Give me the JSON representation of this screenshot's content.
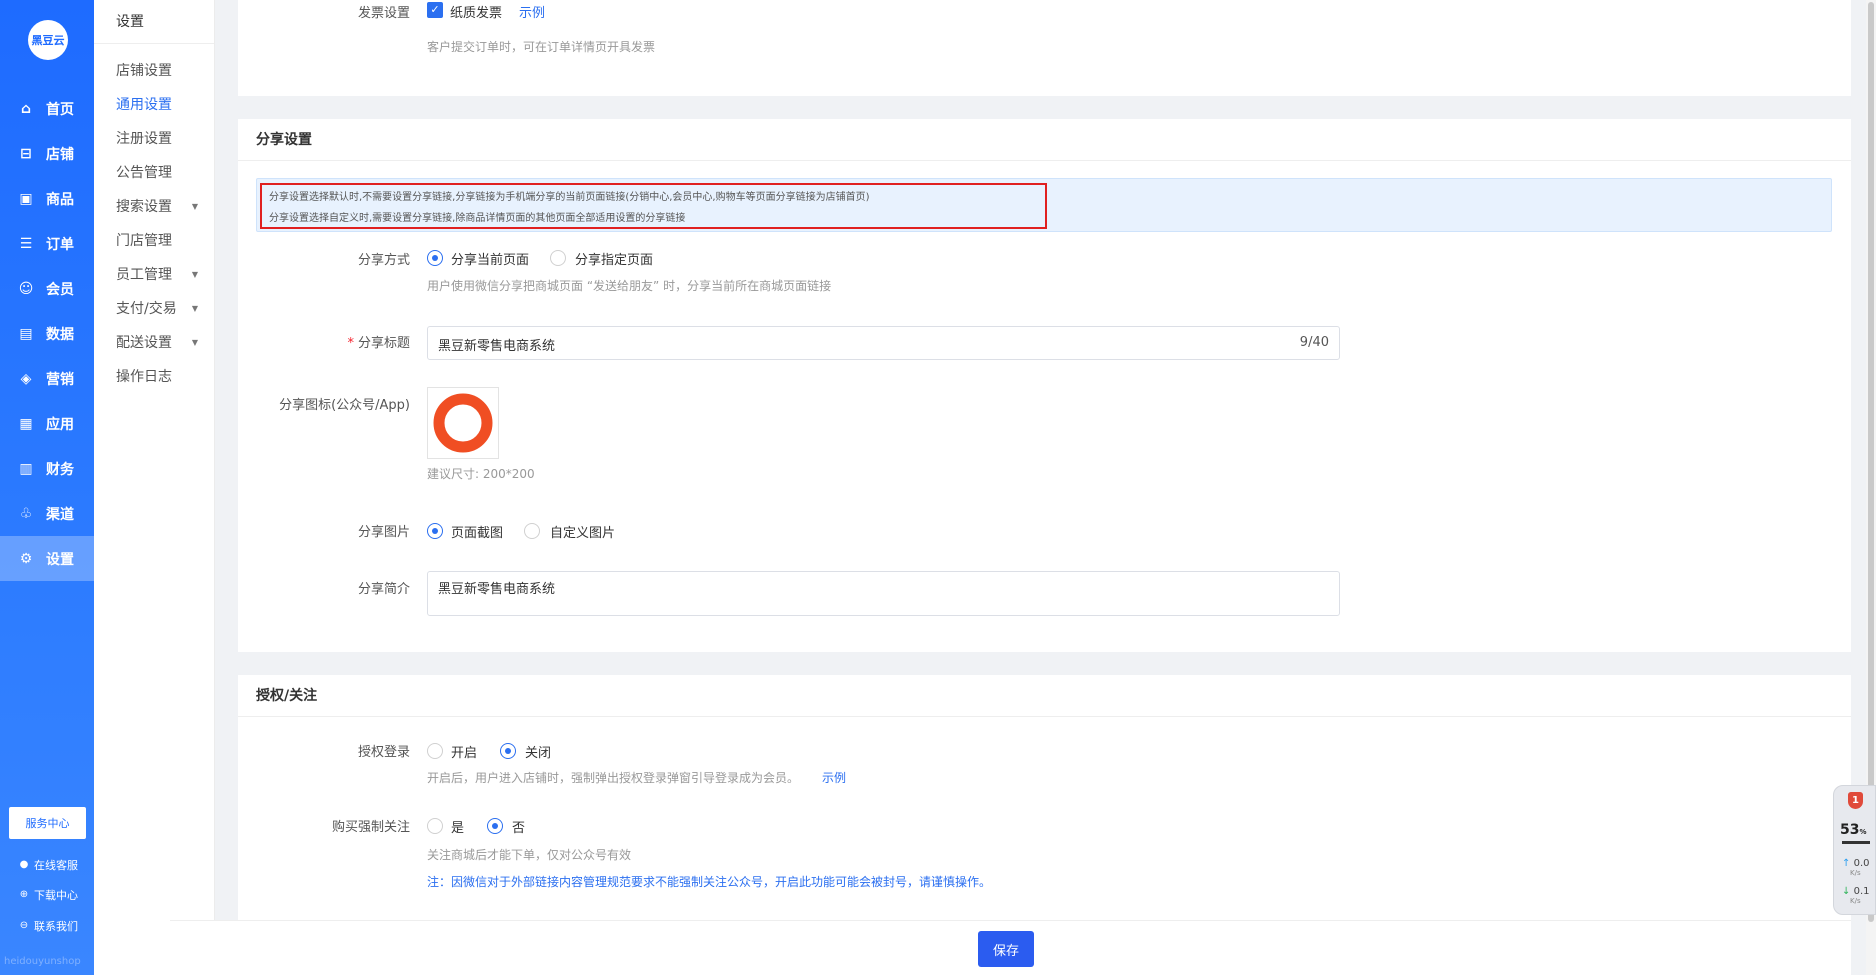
{
  "brand": {
    "logo_text": "黑豆云",
    "watermark": "heidouyunshop"
  },
  "sidebar": {
    "items": [
      {
        "label": "首页",
        "icon": "home-icon",
        "glyph": "⌂"
      },
      {
        "label": "店铺",
        "icon": "store-icon",
        "glyph": "⊟"
      },
      {
        "label": "商品",
        "icon": "goods-icon",
        "glyph": "▣"
      },
      {
        "label": "订单",
        "icon": "order-icon",
        "glyph": "☰"
      },
      {
        "label": "会员",
        "icon": "member-icon",
        "glyph": "☺"
      },
      {
        "label": "数据",
        "icon": "chart-icon",
        "glyph": "▤"
      },
      {
        "label": "营销",
        "icon": "tag-icon",
        "glyph": "◈"
      },
      {
        "label": "应用",
        "icon": "app-icon",
        "glyph": "▦"
      },
      {
        "label": "财务",
        "icon": "finance-icon",
        "glyph": "▥"
      },
      {
        "label": "渠道",
        "icon": "channel-icon",
        "glyph": "♧"
      },
      {
        "label": "设置",
        "icon": "gear-icon",
        "glyph": "⚙"
      }
    ],
    "service_center": "服务中心",
    "links": [
      {
        "label": "在线客服",
        "icon": "chat-icon",
        "glyph": "●"
      },
      {
        "label": "下载中心",
        "icon": "download-icon",
        "glyph": "⊕"
      },
      {
        "label": "联系我们",
        "icon": "contact-icon",
        "glyph": "⊖"
      }
    ]
  },
  "submenu": {
    "title": "设置",
    "items": [
      {
        "label": "店铺设置",
        "arrow": ""
      },
      {
        "label": "通用设置",
        "arrow": ""
      },
      {
        "label": "注册设置",
        "arrow": ""
      },
      {
        "label": "公告管理",
        "arrow": ""
      },
      {
        "label": "搜索设置",
        "arrow": "▼"
      },
      {
        "label": "门店管理",
        "arrow": ""
      },
      {
        "label": "员工管理",
        "arrow": "▼"
      },
      {
        "label": "支付/交易",
        "arrow": "▼"
      },
      {
        "label": "配送设置",
        "arrow": "▼"
      },
      {
        "label": "操作日志",
        "arrow": ""
      }
    ]
  },
  "invoice": {
    "label": "发票设置",
    "checkbox_label": "纸质发票",
    "example_link": "示例",
    "hint": "客户提交订单时，可在订单详情页开具发票"
  },
  "share": {
    "title": "分享设置",
    "alert_line1": "分享设置选择默认时,不需要设置分享链接,分享链接为手机端分享的当前页面链接(分销中心,会员中心,购物车等页面分享链接为店铺首页)",
    "alert_line2": "分享设置选择自定义时,需要设置分享链接,除商品详情页面的其他页面全部适用设置的分享链接",
    "method_label": "分享方式",
    "method_opt1": "分享当前页面",
    "method_opt2": "分享指定页面",
    "method_hint": "用户使用微信分享把商城页面 “发送给朋友” 时，分享当前所在商城页面链接",
    "title_label": "分享标题",
    "title_value": "黑豆新零售电商系统",
    "title_count": "9/40",
    "icon_label": "分享图标(公众号/App)",
    "icon_hint": "建议尺寸: 200*200",
    "image_label": "分享图片",
    "image_opt1": "页面截图",
    "image_opt2": "自定义图片",
    "desc_label": "分享简介",
    "desc_value": "黑豆新零售电商系统"
  },
  "auth": {
    "title": "授权/关注",
    "login_label": "授权登录",
    "login_opt1": "开启",
    "login_opt2": "关闭",
    "login_hint": "开启后，用户进入店铺时，强制弹出授权登录弹窗引导登录成为会员。",
    "login_example": "示例",
    "follow_label": "购买强制关注",
    "follow_opt1": "是",
    "follow_opt2": "否",
    "follow_hint": "关注商城后才能下单，仅对公众号有效",
    "follow_warn": "注：因微信对于外部链接内容管理规范要求不能强制关注公众号，开启此功能可能会被封号，请谨慎操作。"
  },
  "footer": {
    "save_label": "保存"
  },
  "widget": {
    "shield": "1",
    "percent": "53",
    "percent_unit": "%",
    "up": "0.0",
    "up_unit": "K/s",
    "down": "0.1",
    "down_unit": "K/s"
  },
  "colors": {
    "primary": "#2b6ff0",
    "sidebar": "#1e6bff",
    "alert_border": "#e02020",
    "logo_orange": "#f04e23"
  }
}
